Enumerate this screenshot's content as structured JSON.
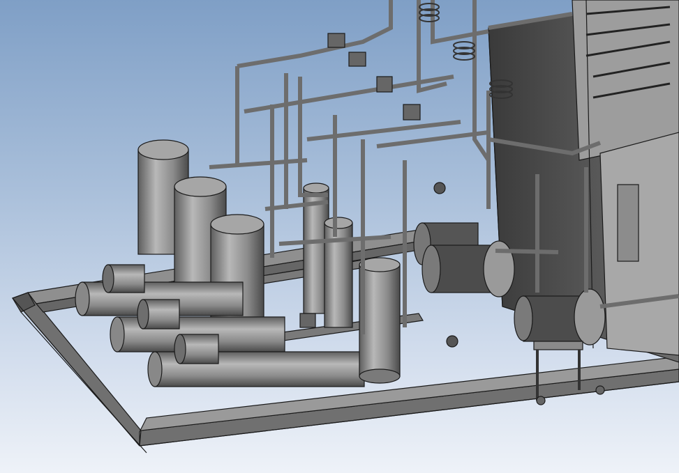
{
  "viewport": {
    "background_top": "#7f9fc6",
    "background_bottom": "#eef2f8",
    "model_color": "#8a8a8a",
    "edge_color": "#1a1a1a"
  },
  "model": {
    "description_icon": "refrigeration-skid-3d-model",
    "components": [
      {
        "name": "skid-base-frame"
      },
      {
        "name": "vertical-receiver-tank",
        "count": 3
      },
      {
        "name": "horizontal-condenser-vessel",
        "count": 3
      },
      {
        "name": "compressor-motor",
        "count": 3
      },
      {
        "name": "electric-pump-motor",
        "count": 3
      },
      {
        "name": "vertical-separator",
        "count": 3
      },
      {
        "name": "pipe-network"
      },
      {
        "name": "valve-manifold"
      },
      {
        "name": "electrical-cabinet"
      }
    ]
  }
}
